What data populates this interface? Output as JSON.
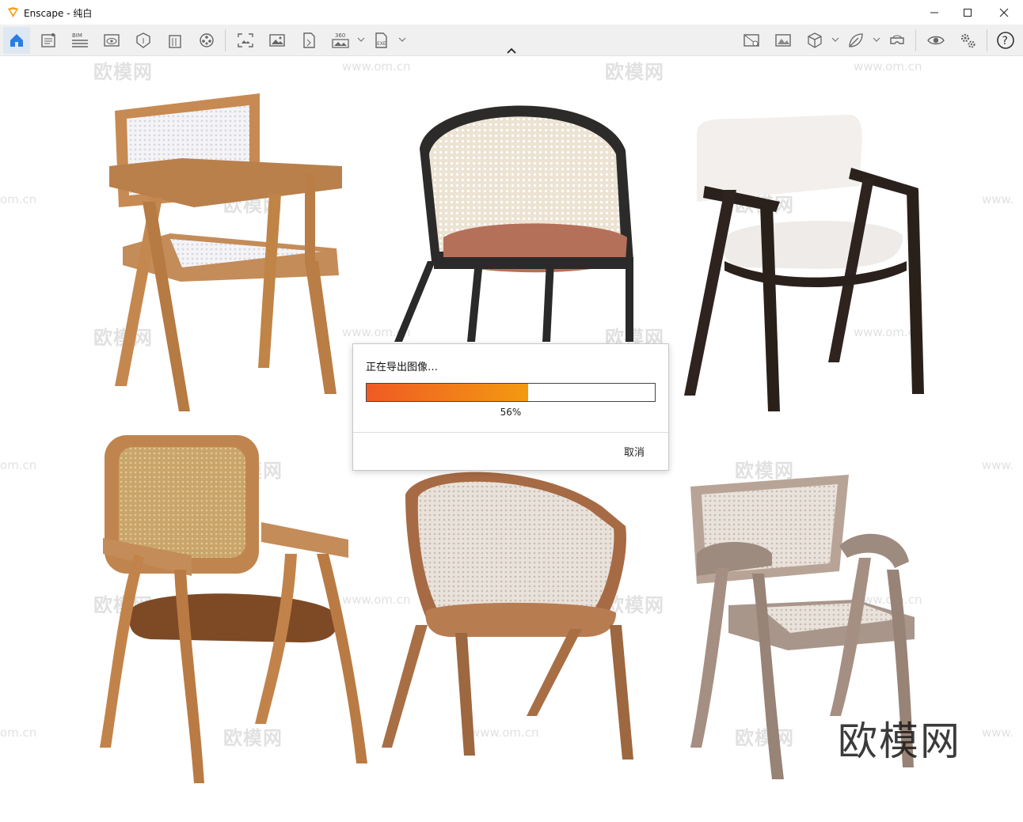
{
  "window": {
    "title": "Enscape - 纯白"
  },
  "toolbar": {
    "left_tools": [
      "home-icon",
      "asset-library-icon",
      "bim-icon",
      "visual-settings-icon",
      "material-icon",
      "building-icon",
      "camera-reel-icon",
      "screenshot-icon",
      "image-icon",
      "export-icon",
      "panorama-360-icon",
      "exe-export-icon"
    ],
    "right_tools": [
      "render-settings-icon",
      "image-settings-icon",
      "cube-icon",
      "leaf-icon",
      "vr-headset-icon",
      "eye-icon",
      "settings-gears-icon",
      "help-icon"
    ],
    "collapse": "chevron-up-icon"
  },
  "watermarks": {
    "brand": "欧模网",
    "url": "www.om.cn",
    "edge": "om.cn",
    "edge_www": "www."
  },
  "dialog": {
    "message": "正在导出图像…",
    "progress": 0.56,
    "percent_text": "56%",
    "cancel_label": "取消"
  },
  "colors": {
    "accent": "#2a7de1",
    "progress_start": "#f05a24",
    "progress_end": "#f39a10"
  }
}
